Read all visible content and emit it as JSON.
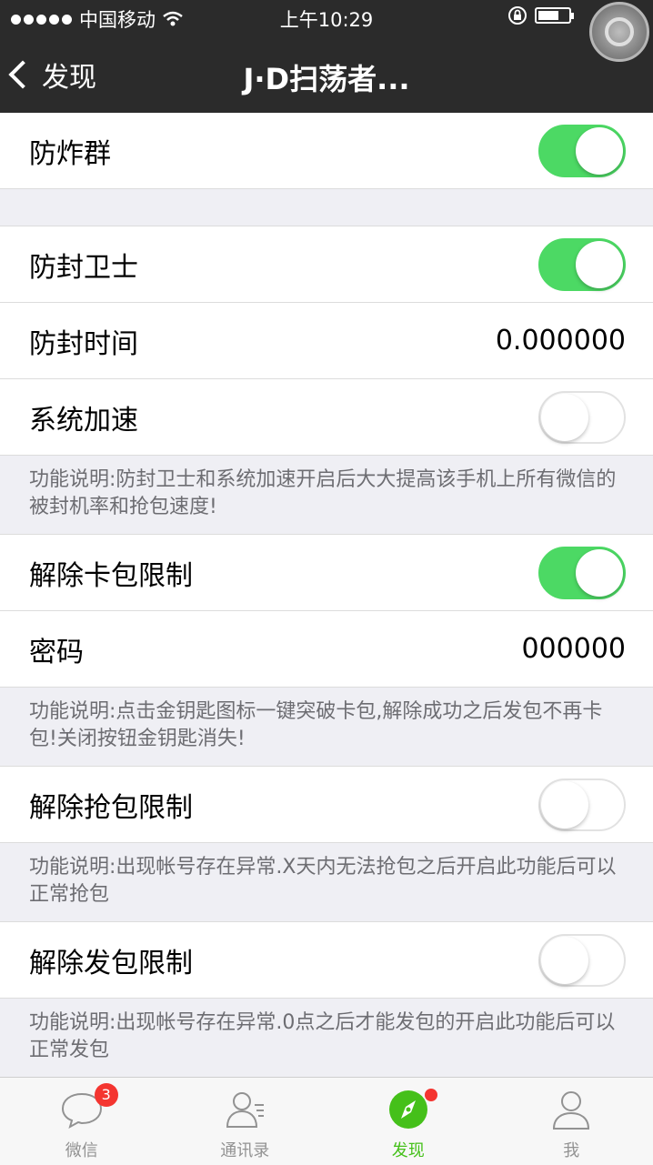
{
  "status_bar": {
    "carrier": "中国移动",
    "time": "上午10:29"
  },
  "nav": {
    "back_label": "发现",
    "title": "J·D扫荡者..."
  },
  "rows": {
    "anti_bomb": {
      "label": "防炸群",
      "on": true
    },
    "guard": {
      "label": "防封卫士",
      "on": true
    },
    "guard_time": {
      "label": "防封时间",
      "value": "0.000000"
    },
    "speedup": {
      "label": "系统加速",
      "on": false
    },
    "desc1": "功能说明:防封卫士和系统加速开启后大大提高该手机上所有微信的被封机率和抢包速度!",
    "unlock_card": {
      "label": "解除卡包限制",
      "on": true
    },
    "password": {
      "label": "密码",
      "value": "000000"
    },
    "desc2": "功能说明:点击金钥匙图标一键突破卡包,解除成功之后发包不再卡包!关闭按钮金钥匙消失!",
    "unlock_grab": {
      "label": "解除抢包限制",
      "on": false
    },
    "desc3": "功能说明:出现帐号存在异常.X天内无法抢包之后开启此功能后可以正常抢包",
    "unlock_send": {
      "label": "解除发包限制",
      "on": false
    },
    "desc4": "功能说明:出现帐号存在异常.0点之后才能发包的开启此功能后可以正常发包"
  },
  "tabs": {
    "chats": {
      "label": "微信",
      "badge": "3"
    },
    "contacts": {
      "label": "通讯录"
    },
    "discover": {
      "label": "发现"
    },
    "me": {
      "label": "我"
    }
  },
  "colors": {
    "toggle_on": "#4cd964",
    "nav_bg": "#2b2b2b",
    "tab_active": "#45c01a",
    "badge": "#f43530"
  }
}
